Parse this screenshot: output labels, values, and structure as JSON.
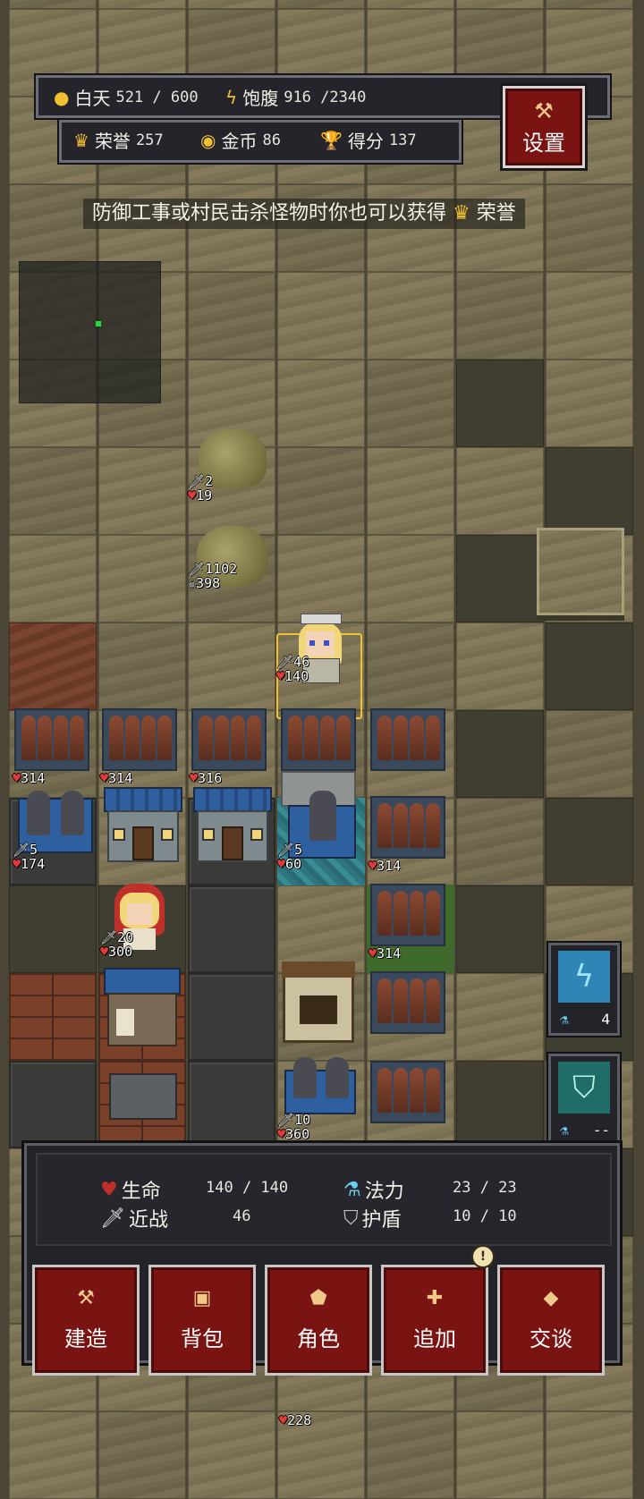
{
  "hud": {
    "day_label": "白天",
    "day_value": "521 / 600",
    "satiety_label": "饱腹",
    "satiety_value": "916 /2340",
    "honor_label": "荣誉",
    "honor_value": "257",
    "gold_label": "金币",
    "gold_value": "86",
    "score_label": "得分",
    "score_value": "137",
    "settings_label": "设置"
  },
  "tip": {
    "text_before": "防御工事或村民击杀怪物时你也可以获得",
    "text_after": "荣誉"
  },
  "units": {
    "slime1": {
      "attack": "2",
      "hp": "19"
    },
    "slime2": {
      "attack": "1102",
      "skull": "398"
    },
    "hero": {
      "attack": "46",
      "hp": "140"
    },
    "barricade1": {
      "hp": "314"
    },
    "barricade2": {
      "hp": "314"
    },
    "barricade3": {
      "hp": "316"
    },
    "barricade_r1": {
      "hp": "314"
    },
    "barricade_r2": {
      "hp": "314"
    },
    "guard1": {
      "attack": "5",
      "hp": "174"
    },
    "guard2": {
      "attack": "5",
      "hp": "60"
    },
    "villager": {
      "attack": "20",
      "hp": "300"
    },
    "guard3": {
      "attack": "10",
      "hp": "360"
    },
    "bottom_building": {
      "hp": "228"
    }
  },
  "skills": [
    {
      "icon": "lightning-rune-icon",
      "cost": "4"
    },
    {
      "icon": "shield-rune-icon",
      "cost": "--"
    }
  ],
  "stats": {
    "hp_label": "生命",
    "hp_value": "140 / 140",
    "mana_label": "法力",
    "mana_value": "23 /  23",
    "melee_label": "近战",
    "melee_value": "46",
    "shield_label": "护盾",
    "shield_value": "10 /  10"
  },
  "actions": [
    {
      "label": "建造",
      "icon": "hammer-icon"
    },
    {
      "label": "背包",
      "icon": "backpack-icon"
    },
    {
      "label": "角色",
      "icon": "character-icon"
    },
    {
      "label": "追加",
      "icon": "plus-icon"
    },
    {
      "label": "交谈",
      "icon": "speech-icon"
    }
  ],
  "colors": {
    "button_red": "#7a1412",
    "hp_red": "#e03a3a",
    "gold": "#f0c030"
  }
}
